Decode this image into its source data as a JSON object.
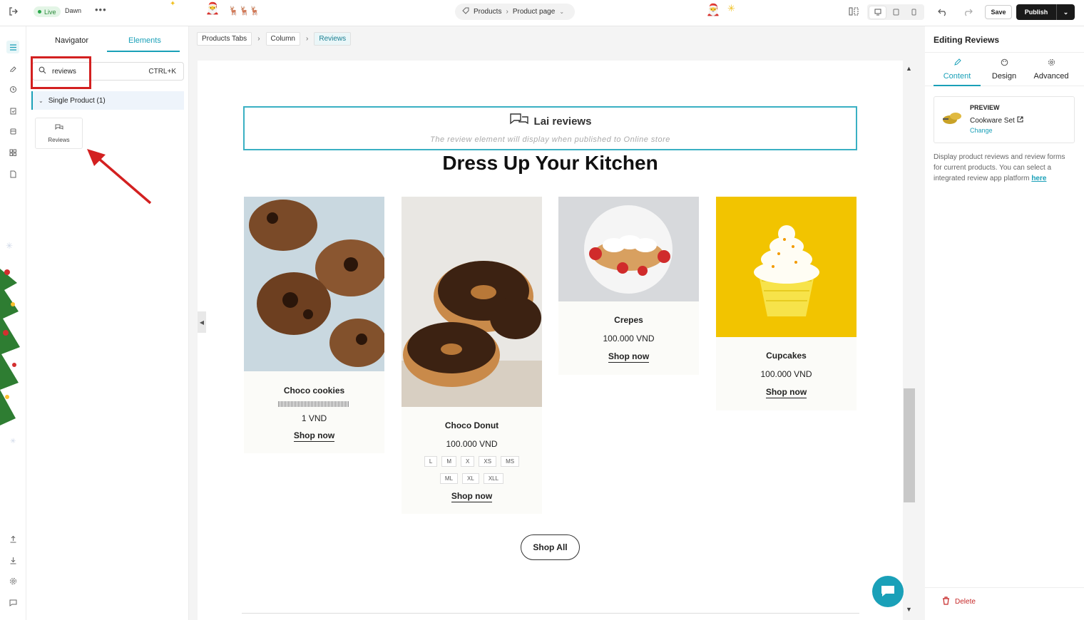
{
  "topbar": {
    "live_label": "Live",
    "theme_name": "Dawn",
    "more_label": "•••",
    "page_selector": {
      "collection": "Products",
      "page": "Product page"
    },
    "save_label": "Save",
    "publish_label": "Publish"
  },
  "left_panel": {
    "tabs": [
      {
        "label": "Navigator"
      },
      {
        "label": "Elements"
      }
    ],
    "active_tab": "Elements",
    "search": {
      "value": "reviews",
      "shortcut": "CTRL+K"
    },
    "group": {
      "label": "Single Product (1)"
    },
    "element": {
      "label": "Reviews"
    }
  },
  "breadcrumb": [
    "Products Tabs",
    "Column",
    "Reviews"
  ],
  "canvas": {
    "reviews_block": {
      "title": "Lai reviews",
      "note": "The review element will display when published to Online store"
    },
    "heading": "Dress Up Your Kitchen",
    "products": [
      {
        "name": "Choco cookies",
        "price": "1 VND",
        "shop": "Shop now"
      },
      {
        "name": "Choco Donut",
        "price": "100.000 VND",
        "shop": "Shop now",
        "sizes_row1": [
          "L",
          "M",
          "X",
          "XS",
          "MS"
        ],
        "sizes_row2": [
          "ML",
          "XL",
          "XLL"
        ]
      },
      {
        "name": "Crepes",
        "price": "100.000 VND",
        "shop": "Shop now"
      },
      {
        "name": "Cupcakes",
        "price": "100.000 VND",
        "shop": "Shop now"
      }
    ],
    "shop_all": "Shop All"
  },
  "right_panel": {
    "title": "Editing Reviews",
    "tabs": [
      {
        "label": "Content"
      },
      {
        "label": "Design"
      },
      {
        "label": "Advanced"
      }
    ],
    "active_tab": "Content",
    "preview": {
      "label": "PREVIEW",
      "product": "Cookware Set",
      "change": "Change"
    },
    "description": "Display product reviews and review forms for current products. You can select a integrated review app platform",
    "description_link": "here",
    "delete_label": "Delete"
  },
  "colors": {
    "accent": "#1aa0b8",
    "annotation": "#d32020",
    "publish": "#1a1a1a",
    "delete": "#c62828"
  }
}
